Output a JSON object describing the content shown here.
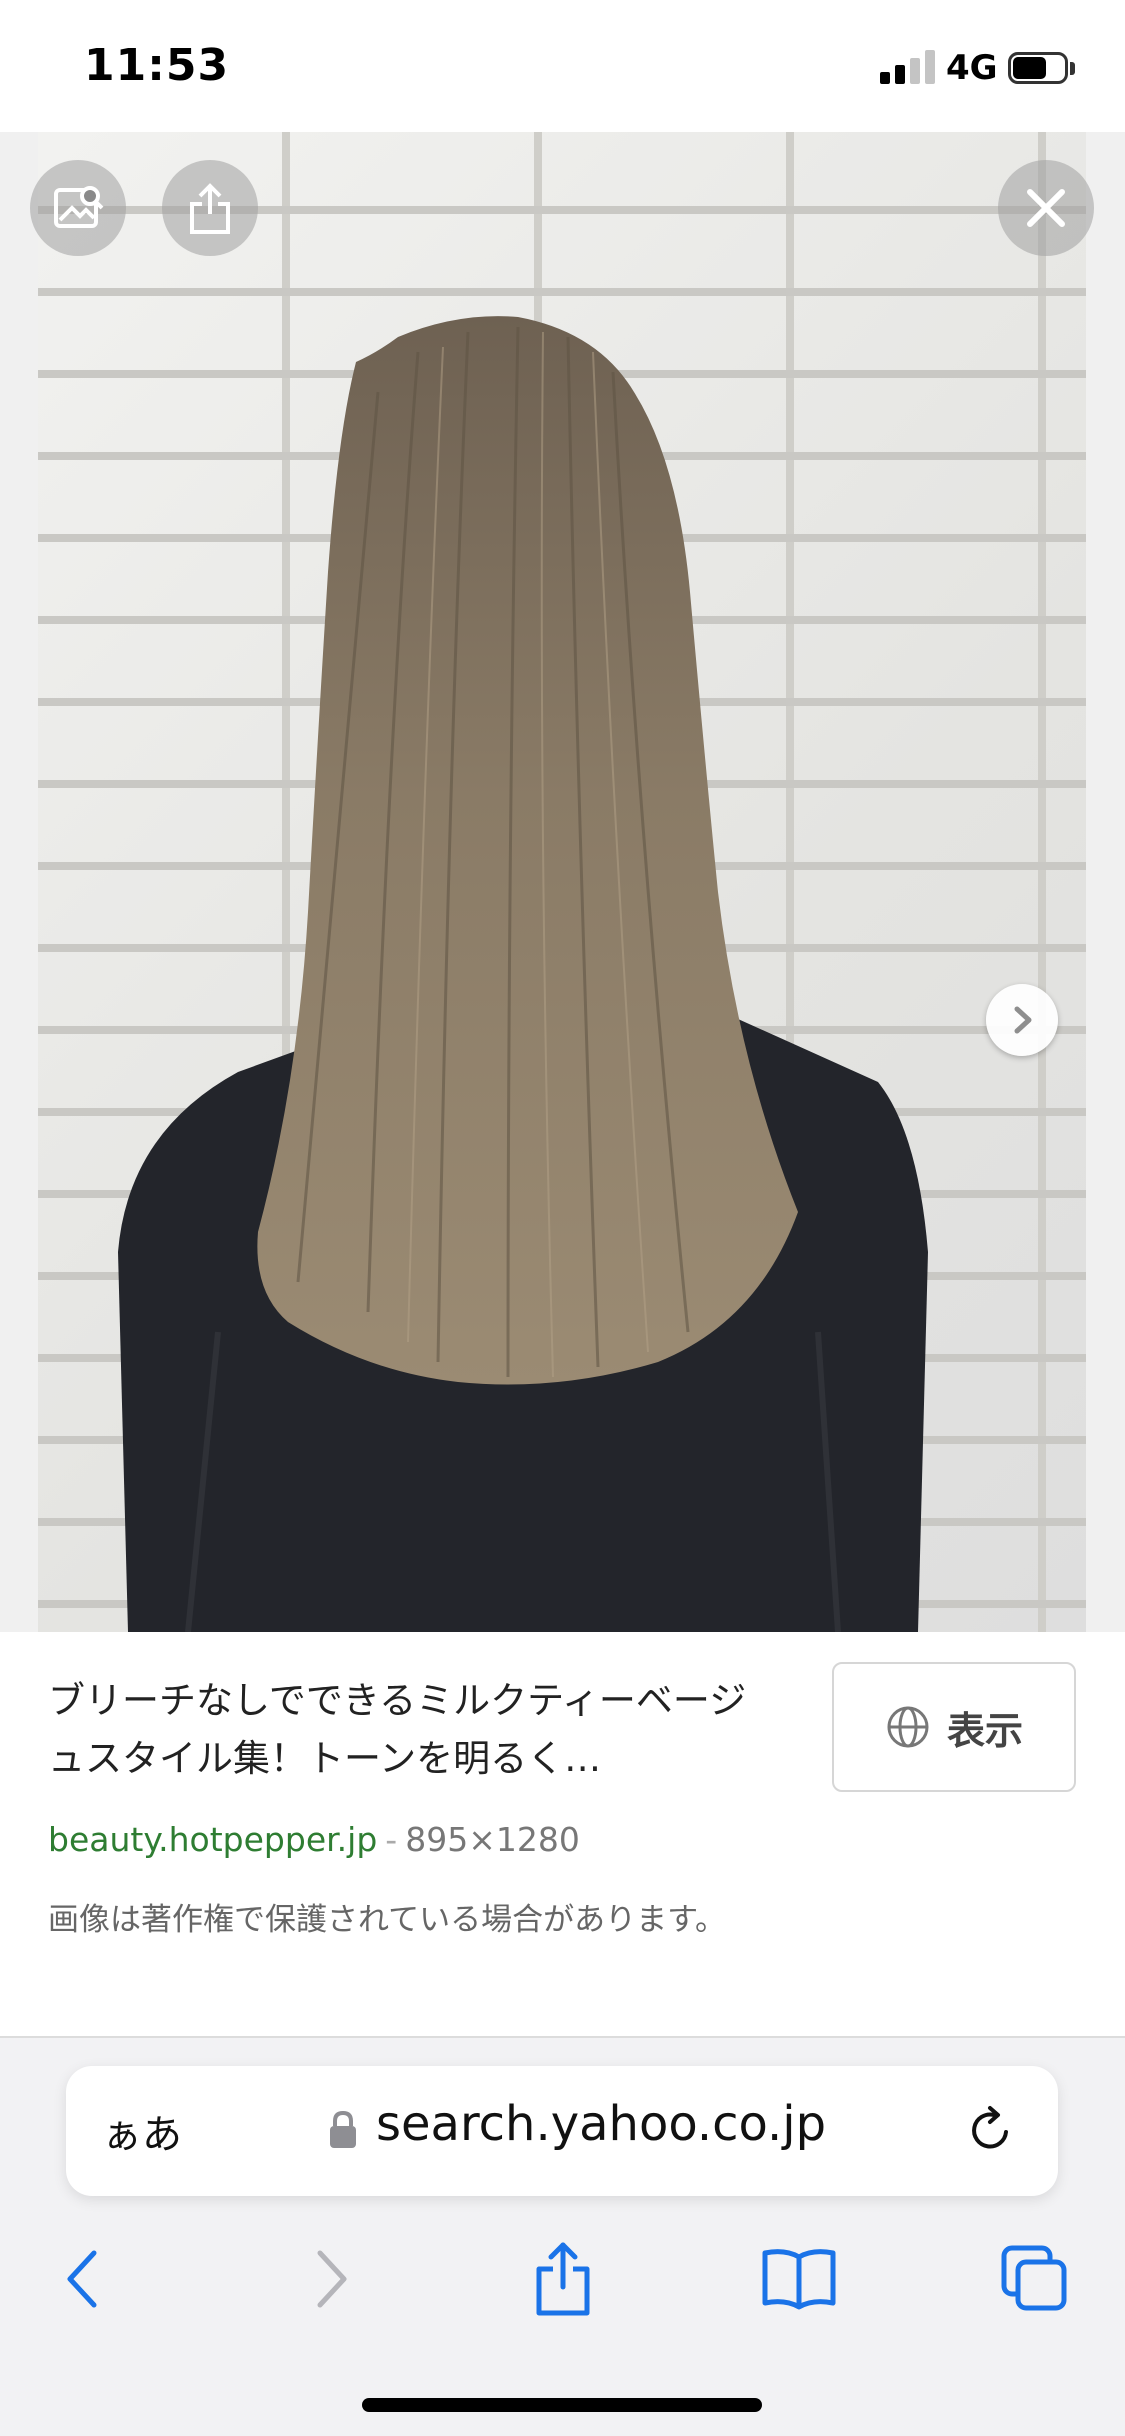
{
  "status_bar": {
    "time": "11:53",
    "network": "4G",
    "signal_bars_active": 2,
    "signal_bars_total": 4,
    "battery_level": 0.65
  },
  "viewer": {
    "buttons": {
      "visual_search": "image-search-icon",
      "share": "share-icon",
      "close": "close-icon",
      "next": "chevron-right-icon"
    }
  },
  "result": {
    "title": "ブリーチなしでできるミルクティーベージュスタイル集！トーンを明るく…",
    "view_button_label": "表示",
    "source_domain": "beauty.hotpepper.jp",
    "separator": "-",
    "dimensions": "895×1280",
    "copyright_note": "画像は著作権で保護されている場合があります。"
  },
  "browser": {
    "aa_label": "ぁあ",
    "url": "search.yahoo.co.jp",
    "toolbar": [
      "back-icon",
      "forward-icon",
      "share-icon",
      "bookmarks-icon",
      "tabs-icon"
    ],
    "accent_color": "#1a73e8",
    "disabled_color": "#b5b5ba"
  }
}
